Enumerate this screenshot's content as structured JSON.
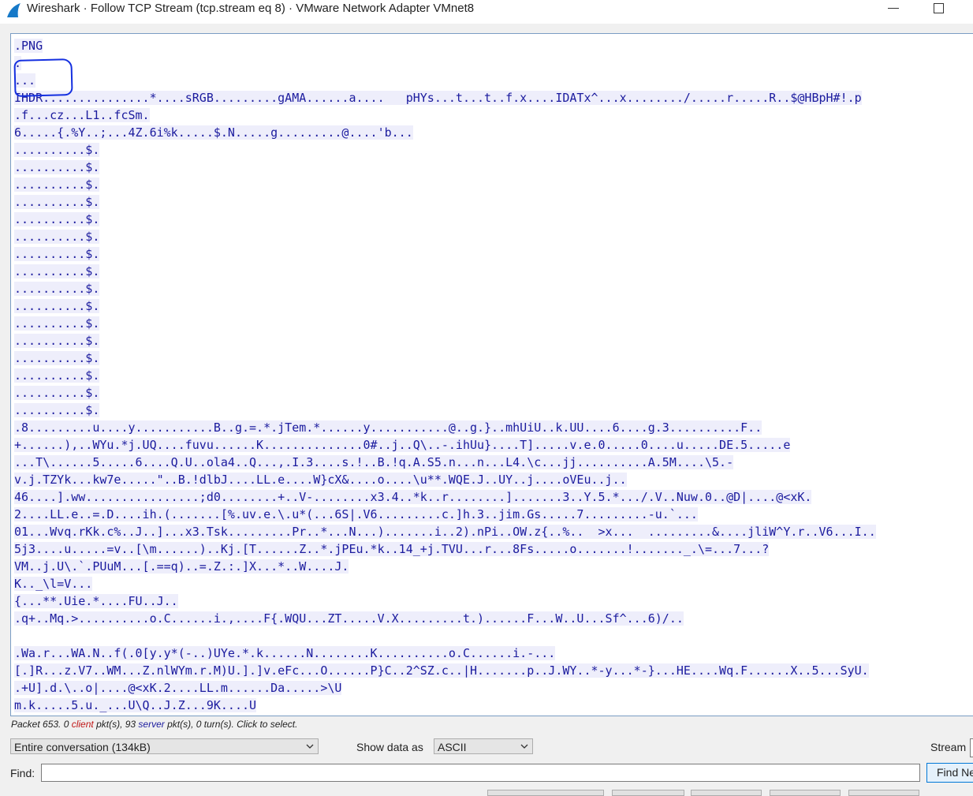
{
  "window": {
    "title": "Wireshark · Follow TCP Stream (tcp.stream eq 8) · VMware Network Adapter VMnet8"
  },
  "stream": {
    "lines": [
      ".PNG",
      ".",
      "...",
      "IHDR...............*....sRGB.........gAMA......a....   pHYs...t...t..f.x....IDATx^...x......../.....r.....R..$@HBpH#!.p",
      ".f...cz...L1..fcSm.",
      "6.....{.%Y..;...4Z.6i%k.....$.N.....g.........@....'b...",
      "..........$.",
      "..........$.",
      "..........$.",
      "..........$.",
      "..........$.",
      "..........$.",
      "..........$.",
      "..........$.",
      "..........$.",
      "..........$.",
      "..........$.",
      "..........$.",
      "..........$.",
      "..........$.",
      "..........$.",
      "..........$.",
      ".8.........u....y...........B..g.=.*.jTem.*......y...........@..g.}..mhUiU..k.UU....6....g.3..........F..",
      "+......),..WYu.*j.UQ....fuvu......K..............0#..j..Q\\..-.ihUu}....T].....v.e.0.....0....u.....DE.5.....e",
      "...T\\......5.....6....Q.U..ola4..Q...,.I.3....s.!..B.!q.A.S5.n...n...L4.\\c...jj..........A.5M....\\5.-",
      "v.j.TZYk...kw7e.....\"..B.!dlbJ....LL.e....W}cX&....o....\\u**.WQE.J..UY..j....oVEu..j..",
      "46....].ww................;d0........+..V-........x3.4..*k..r........].......3..Y.5.*.../.V..Nuw.0..@D|....@<xK.",
      "2....LL.e..=.D....ih.(.......[%.uv.e.\\.u*(...6S|.V6.........c.]h.3..jim.Gs.....7.........-u.`...",
      "01...Wvq.rKk.c%..J..]...x3.Tsk.........Pr..*...N...).......i..2).nPi..OW.z{..%..  >x...  .........&....jliW^Y.r..V6...I..",
      "5j3....u.....=v..[\\m......)..Kj.[T......Z..*.jPEu.*k..14_+j.TVU...r...8Fs.....o.......!......._.\\=...7...?",
      "VM..j.U\\.`.PUuM...[.==q)..=.Z.:.]X...*..W....J.",
      "K.._\\l=V...",
      "{...**.Uie.*....FU..J..",
      ".q+..Mq.>..........o.C......i.,....F{.WQU...ZT.....V.X.........t.)......F...W..U...Sf^...6)/..",
      "",
      ".Wa.r...WA.N..f(.0[y.y*(-..)UYe.*.k......N........K..........o.C......i.-...",
      "[.]R...z.V7..WM...Z.nlWYm.r.M)U.].]v.eFc...O......P}C..2^SZ.c..|H.......p..J.WY..*-y...*-}...HE....Wq.F......X..5...SyU.",
      ".+U].d.\\..o|....@<xK.2....LL.m......Da.....>\\U",
      "m.k.....5.u._...U\\Q..J.Z...9K....U"
    ]
  },
  "status": {
    "prefix": "Packet 653. 0 ",
    "client_word": "client",
    "middle": " pkt(s), 93 ",
    "server_word": "server",
    "suffix": " pkt(s), 0 turn(s). Click to select."
  },
  "controls": {
    "conversation_select": "Entire conversation (134kB)",
    "show_data_as_label": "Show data as",
    "show_data_as_value": "ASCII",
    "stream_label": "Stream",
    "find_label": "Find:",
    "find_value": "",
    "find_next_label": "Find Ne"
  },
  "colors": {
    "stream_text": "#1b1b9e",
    "client_text": "#c01818",
    "annotation": "#1530e0"
  }
}
